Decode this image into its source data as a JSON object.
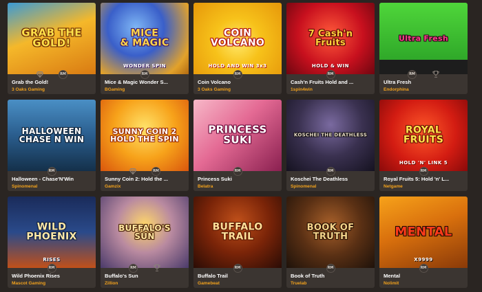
{
  "accent": "#f2a21d",
  "badge_text": "RM",
  "games": [
    {
      "name": "Grab the Gold!",
      "provider": "3 Oaks Gaming",
      "art_title": "GRAB THE\nGOLD!",
      "art_sub": "",
      "bg": "linear-gradient(160deg,#3a9ad6 0%,#f5b82a 45%,#d97a12 100%)",
      "title_color": "#ffe14a",
      "title_stroke": "#6b2a05",
      "title_size": 15,
      "gem": true,
      "trophy": false
    },
    {
      "name": "Mice & Magic Wonder S...",
      "provider": "BGaming",
      "art_title": "MICE\n& MAGIC",
      "art_sub": "WONDER SPIN",
      "bg": "radial-gradient(circle at 40% 35%,#7fb7f5 0%,#3a5fc9 40%,#e2a22b 80%,#b36a10 100%)",
      "title_color": "#ffd54a",
      "title_stroke": "#3b1a6b",
      "title_size": 14,
      "gem": false,
      "trophy": false
    },
    {
      "name": "Coin Volcano",
      "provider": "3 Oaks Gaming",
      "art_title": "COIN\nVOLCANO",
      "art_sub": "HOLD AND WIN  3x3",
      "bg": "radial-gradient(circle at 50% 55%,#ffe86a 0%,#f7c21a 40%,#e6970a 100%)",
      "title_color": "#ffffff",
      "title_stroke": "#b01010",
      "title_size": 14,
      "gem": false,
      "trophy": false
    },
    {
      "name": "Cash'n Fruits Hold and ...",
      "provider": "1spin4win",
      "art_title": "7 Cash'n\nFruits",
      "art_sub": "HOLD & WIN",
      "bg": "radial-gradient(circle at 50% 45%,#ff5a3a 0%,#c8101e 55%,#6e0610 100%)",
      "title_color": "#ffd23a",
      "title_stroke": "#5a0508",
      "title_size": 13,
      "gem": false,
      "trophy": false
    },
    {
      "name": "Ultra Fresh",
      "provider": "Endorphina",
      "art_title": "Ultra Fresh",
      "art_sub": "",
      "bg": "linear-gradient(180deg,#4fd63a 0%,#2fa829 80%,#1d1d1d 80%,#1d1d1d 100%)",
      "title_color": "#ff3c8a",
      "title_stroke": "#2a0a1a",
      "title_size": 11,
      "gem": false,
      "trophy": true
    },
    {
      "name": "Halloween - Chase'N'Win",
      "provider": "Spinomenal",
      "art_title": "HALLOWEEN\nCHASE N WIN",
      "art_sub": "",
      "bg": "linear-gradient(180deg,#4a8fc5 0%,#2a5d8d 50%,#14304a 100%)",
      "title_color": "#ffffff",
      "title_stroke": "#10243a",
      "title_size": 12,
      "gem": false,
      "trophy": false
    },
    {
      "name": "Sunny Coin 2: Hold the ...",
      "provider": "Gamzix",
      "art_title": "SUNNY COIN 2\nHOLD THE SPIN",
      "art_sub": "",
      "bg": "radial-gradient(circle at 50% 40%,#ffe36a 0%,#f7a21a 50%,#d9560d 100%)",
      "title_color": "#ffffff",
      "title_stroke": "#9c2d05",
      "title_size": 11,
      "gem": true,
      "trophy": false
    },
    {
      "name": "Princess Suki",
      "provider": "Belatra",
      "art_title": "PRINCESS\nSUKI",
      "art_sub": "",
      "bg": "linear-gradient(135deg,#f7b8c8 0%,#e46a94 45%,#8a2050 100%)",
      "title_color": "#ffffff",
      "title_stroke": "#6b0a3a",
      "title_size": 15,
      "gem": false,
      "trophy": false
    },
    {
      "name": "Koschei The Deathless",
      "provider": "Spinomenal",
      "art_title": "KOSCHEI THE DEATHLESS",
      "art_sub": "",
      "bg": "radial-gradient(circle at 50% 35%,#7a6aa0 0%,#3a3150 50%,#151220 100%)",
      "title_color": "#e6dcc5",
      "title_stroke": "#151015",
      "title_size": 7,
      "gem": false,
      "trophy": false
    },
    {
      "name": "Royal Fruits 5: Hold 'n' L...",
      "provider": "Netgame",
      "art_title": "ROYAL\nFRUITS",
      "art_sub": "HOLD 'N' LINK  5",
      "bg": "radial-gradient(circle at 50% 45%,#ff5a2a 0%,#d31c12 55%,#8a0a0a 100%)",
      "title_color": "#ffe14a",
      "title_stroke": "#6b1005",
      "title_size": 14,
      "gem": false,
      "trophy": false
    },
    {
      "name": "Wild Phoenix Rises",
      "provider": "Mascot Gaming",
      "art_title": "WILD\nPHOENIX",
      "art_sub": "RISES",
      "bg": "linear-gradient(180deg,#1a2b5a 0%,#2a4a8a 50%,#c0501a 100%)",
      "title_color": "#ffe9a8",
      "title_stroke": "#102040",
      "title_size": 14,
      "gem": false,
      "trophy": false
    },
    {
      "name": "Buffalo's Sun",
      "provider": "Zillion",
      "art_title": "BUFFALO'S\nSUN",
      "art_sub": "",
      "bg": "radial-gradient(circle at 50% 40%,#ffd76a 0%,#b98aa0 45%,#4a3a6a 100%)",
      "title_color": "#ffe6a0",
      "title_stroke": "#4a2408",
      "title_size": 12,
      "gem": false,
      "trophy": true
    },
    {
      "name": "Buffalo Trail",
      "provider": "Gamebeat",
      "art_title": "BUFFALO\nTRAIL",
      "art_sub": "",
      "bg": "radial-gradient(circle at 50% 35%,#c0501a 0%,#7a2408 50%,#2a0c05 100%)",
      "title_color": "#ffe09a",
      "title_stroke": "#5a1a05",
      "title_size": 14,
      "gem": false,
      "trophy": false
    },
    {
      "name": "Book of Truth",
      "provider": "Truelab",
      "art_title": "BOOK OF\nTRUTH",
      "art_sub": "",
      "bg": "radial-gradient(circle at 50% 40%,#a8602a 0%,#5a3014 50%,#1e120a 100%)",
      "title_color": "#f3d38a",
      "title_stroke": "#2a1205",
      "title_size": 13,
      "gem": false,
      "trophy": false
    },
    {
      "name": "Mental",
      "provider": "Nolimit",
      "art_title": "MENTAL",
      "art_sub": "X9999",
      "bg": "linear-gradient(160deg,#f7a21a 0%,#d9700d 45%,#8a3a08 100%)",
      "title_color": "#ff3a1a",
      "title_stroke": "#1a0a05",
      "title_size": 18,
      "gem": false,
      "trophy": false
    }
  ]
}
